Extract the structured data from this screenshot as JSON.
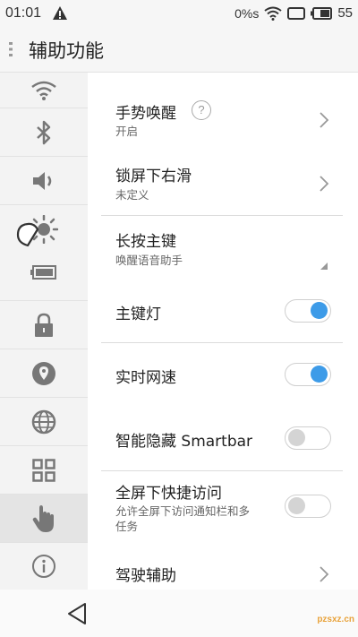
{
  "status_bar": {
    "time": "01:01",
    "data_rate": "0%s",
    "battery_level": "55",
    "icons": [
      "warning-icon",
      "wifi-icon",
      "screen-icon",
      "battery-icon"
    ]
  },
  "header": {
    "title": "辅助功能",
    "menu_icon": "menu-icon"
  },
  "sidebar": {
    "items": [
      {
        "icon": "wifi-icon"
      },
      {
        "icon": "bluetooth-icon"
      },
      {
        "icon": "volume-icon"
      },
      {
        "icon": "brightness-icon"
      },
      {
        "icon": "lock-icon"
      },
      {
        "icon": "location-icon"
      },
      {
        "icon": "globe-icon"
      },
      {
        "icon": "grid-icon"
      },
      {
        "icon": "hand-gesture-icon",
        "selected": true
      },
      {
        "icon": "info-icon"
      }
    ]
  },
  "settings": {
    "gesture_wake": {
      "title": "手势唤醒",
      "help": "?",
      "subtitle": "开启"
    },
    "lockscreen_swipe": {
      "title": "锁屏下右滑",
      "subtitle": "未定义"
    },
    "long_press_home": {
      "title": "长按主键",
      "subtitle": "唤醒语音助手"
    },
    "home_key_light": {
      "title": "主键灯",
      "enabled": true
    },
    "realtime_speed": {
      "title": "实时网速",
      "enabled": true
    },
    "smart_hide": {
      "title": "智能隐藏 Smartbar",
      "enabled": false
    },
    "fullscreen_access": {
      "title": "全屏下快捷访问",
      "subtitle_line1": "允许全屏下访问通知栏和多",
      "subtitle_line2": "任务",
      "enabled": false
    },
    "driving_assist": {
      "title": "驾驶辅助"
    }
  },
  "nav_bar": {
    "back_icon": "back-triangle-icon",
    "watermark": "pzsxz.cn"
  },
  "colors": {
    "toggle_on": "#3d9be8",
    "toggle_off": "#d4d4d4",
    "sidebar_bg": "#f3f3f3",
    "selected_bg": "#e4e4e4"
  }
}
